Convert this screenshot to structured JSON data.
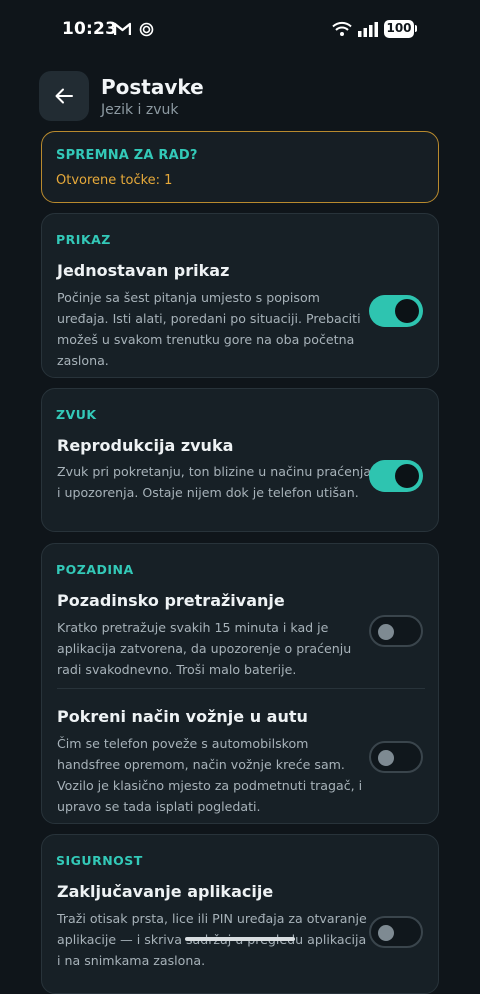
{
  "status_bar": {
    "time": "10:23",
    "battery": "100"
  },
  "header": {
    "title": "Postavke",
    "subtitle": "Jezik i zvuk"
  },
  "ready_card": {
    "title": "SPREMNA ZA RAD?",
    "text": "Otvorene točke: 1"
  },
  "sections": {
    "display": {
      "label": "PRIKAZ",
      "title": "Jednostavan prikaz",
      "description": "Počinje sa šest pitanja umjesto s popisom uređaja. Isti alati, poredani po situaciji. Prebaciti možeš u svakom trenutku gore na oba početna zaslona.",
      "enabled": true
    },
    "sound": {
      "label": "ZVUK",
      "title": "Reprodukcija zvuka",
      "description": "Zvuk pri pokretanju, ton blizine u načinu praćenja i upozorenja. Ostaje nijem dok je telefon utišan.",
      "enabled": true
    },
    "background": {
      "label": "POZADINA",
      "scan_title": "Pozadinsko pretraživanje",
      "scan_description": "Kratko pretražuje svakih 15 minuta i kad je aplikacija zatvorena, da upozorenje o praćenju radi svakodnevno. Troši malo baterije.",
      "scan_enabled": false,
      "drive_title": "Pokreni način vožnje u autu",
      "drive_description": "Čim se telefon poveže s automobilskom handsfree opremom, način vožnje kreće sam. Vozilo je klasično mjesto za podmetnuti tragač, i upravo se tada isplati pogledati.",
      "drive_enabled": false
    },
    "security": {
      "label": "SIGURNOST",
      "title": "Zaključavanje aplikacije",
      "description": "Traži otisak prsta, lice ili PIN uređaja za otvaranje aplikacije — i skriva sadržaj u pregledu aplikacija i na snimkama zaslona.",
      "enabled": false
    }
  },
  "colors": {
    "accent": "#2ec4b0",
    "warning": "#e6a93a",
    "background": "#0f151a"
  }
}
